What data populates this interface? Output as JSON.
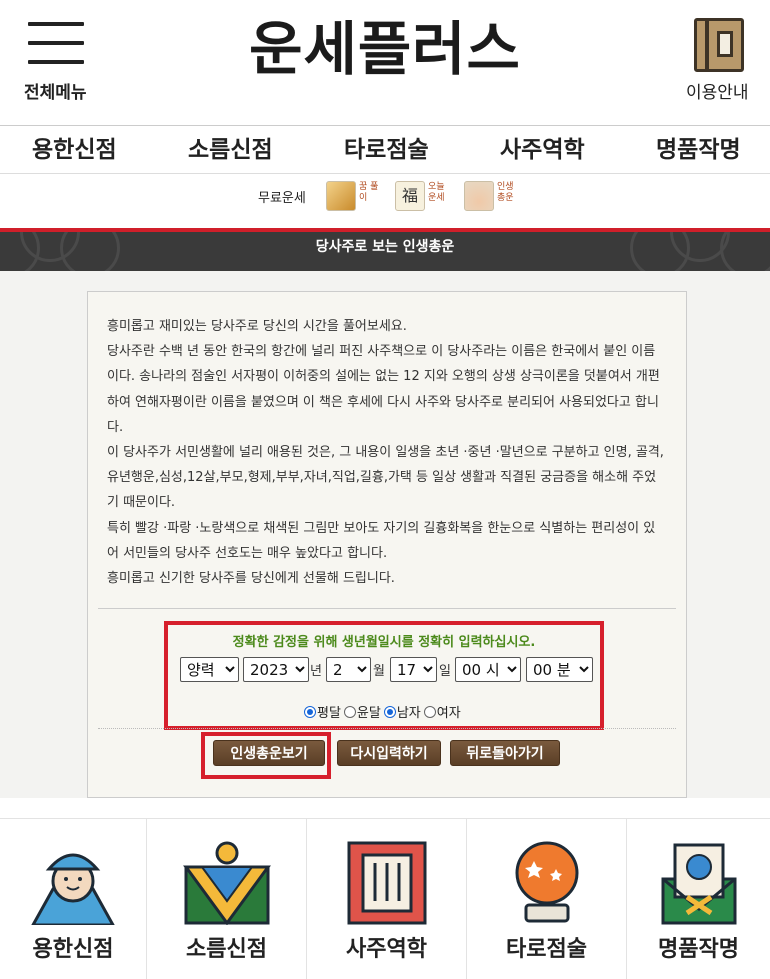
{
  "header": {
    "menu_label": "전체메뉴",
    "logo": "운세플러스",
    "guide_label": "이용안내"
  },
  "nav": [
    "용한신점",
    "소름신점",
    "타로점술",
    "사주역학",
    "명품작명"
  ],
  "free": {
    "label": "무료운세",
    "items": [
      {
        "text": "꿈 풀이",
        "icon": "dream-icon"
      },
      {
        "text": "오늘 운세",
        "icon": "fortune-icon"
      },
      {
        "text": "인생 총운",
        "icon": "life-icon"
      }
    ]
  },
  "title": "당사주로 보는 인생총운",
  "intro": [
    "흥미롭고 재미있는 당사주로 당신의 시간을 풀어보세요.",
    "당사주란 수백 년 동안 한국의 항간에 널리 퍼진 사주책으로 이 당사주라는 이름은 한국에서 붙인 이름이다. 송나라의 점술인 서자평이 이허중의 설에는 없는 12 지와 오행의 상생 상극이론을 덧붙여서 개편하여 연해자평이란 이름을 붙였으며 이 책은 후세에 다시 사주와 당사주로 분리되어 사용되었다고 합니다.",
    "이 당사주가 서민생활에 널리 애용된 것은, 그 내용이 일생을 초년 ·중년 ·말년으로 구분하고 인명, 골격,유년행운,심성,12살,부모,형제,부부,자녀,직업,길흉,가택 등 일상 생활과 직결된 궁금증을 해소해 주었기 때문이다.",
    "특히 빨강 ·파랑 ·노랑색으로 채색된 그림만 보아도 자기의 길흉화복을 한눈으로 식별하는 편리성이 있어 서민들의 당사주 선호도는 매우 높았다고 합니다.",
    "흥미롭고 신기한 당사주를 당신에게 선물해 드립니다."
  ],
  "form": {
    "notice": "정확한 감정을 위해 생년월일시를 정확히 입력하십시오.",
    "calendar": "양력",
    "year": "2023",
    "year_unit": "년",
    "month": "2",
    "month_unit": "월",
    "day": "17",
    "day_unit": "일",
    "hour": "00 시",
    "minute": "00 분",
    "options": [
      "평달",
      "윤달",
      "남자",
      "여자"
    ]
  },
  "buttons": {
    "view": "인생총운보기",
    "reset": "다시입력하기",
    "back": "뒤로돌아가기"
  },
  "tiles": [
    "용한신점",
    "소름신점",
    "사주역학",
    "타로점술",
    "명품작명"
  ],
  "colors": {
    "accent_red": "#d61f2c",
    "notice_green": "#4c8a1c",
    "button_brown": "#6a4a30",
    "titlebar": "#3a3a3a"
  }
}
